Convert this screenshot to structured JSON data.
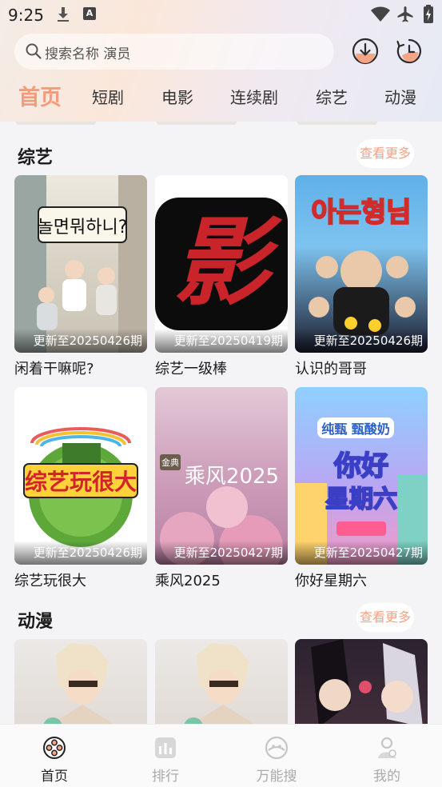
{
  "status": {
    "time": "9:25"
  },
  "search": {
    "placeholder": "搜索名称 演员"
  },
  "tabs": [
    "首页",
    "短剧",
    "电影",
    "连续剧",
    "综艺",
    "动漫"
  ],
  "sections": [
    {
      "title": "综艺",
      "more": "查看更多",
      "items": [
        {
          "name": "闲着干嘛呢?",
          "update": "更新至20250426期"
        },
        {
          "name": "综艺一级棒",
          "update": "更新至20250419期",
          "poster_glyph": "影"
        },
        {
          "name": "认识的哥哥",
          "update": "更新至20250426期"
        },
        {
          "name": "综艺玩很大",
          "update": "更新至20250426期"
        },
        {
          "name": "乘风2025",
          "update": "更新至20250427期"
        },
        {
          "name": "你好星期六",
          "update": "更新至20250427期"
        }
      ]
    },
    {
      "title": "动漫",
      "more": "查看更多"
    }
  ],
  "nav": [
    "首页",
    "排行",
    "万能搜",
    "我的"
  ],
  "colors": {
    "accent": "#f59b7c",
    "more_text": "#f4a283",
    "nav_inactive": "#aaaaaa"
  }
}
